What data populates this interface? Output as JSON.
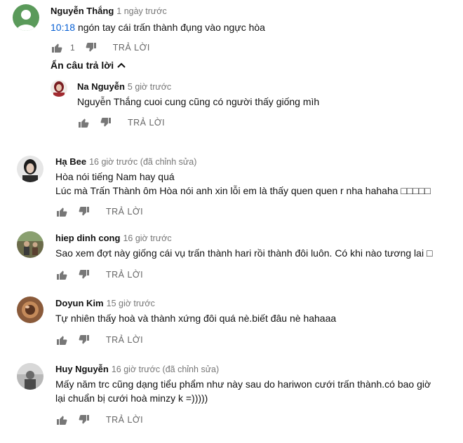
{
  "comments": [
    {
      "author": "Nguyễn Thắng",
      "time": "1 ngày trước",
      "timestamp_link": "10:18",
      "text": "ngón tay cái trấn thành đụng vào ngực hòa",
      "likes": "1",
      "reply_label": "TRẢ LỜI",
      "avatar_color": "#5a9a5a"
    },
    {
      "author": "Na Nguyễn",
      "time": "5 giờ trước",
      "text": "Nguyễn Thắng cuoi cung cũng có người thấy giống mìh",
      "reply_label": "TRẢ LỜI"
    },
    {
      "author": "Hạ Bee",
      "time": "16 giờ trước (đã chỉnh sửa)",
      "lines": [
        "Hòa nói tiếng Nam hay quá",
        "Lúc mà Trấn Thành ôm Hòa nói anh xin lỗi em là thấy quen quen r nha hahaha □□□□□"
      ],
      "reply_label": "TRẢ LỜI"
    },
    {
      "author": "hiep dinh cong",
      "time": "16 giờ trước",
      "text": "Sao xem đợt này giống cái vụ trấn thành hari rồi thành đôi luôn. Có khi nào tương lai □",
      "reply_label": "TRẢ LỜI"
    },
    {
      "author": "Doyun Kim",
      "time": "15 giờ trước",
      "text": "Tự nhiên thấy hoà và thành xứng đôi quá nè.biết đâu nè hahaaa",
      "reply_label": "TRẢ LỜI"
    },
    {
      "author": "Huy Nguyễn",
      "time": "16 giờ trước (đã chỉnh sửa)",
      "lines": [
        "Mấy năm trc cũng dạng tiểu phẩm như này sau do hariwon cưới trấn thành.có bao giờ",
        "lại chuẩn bị cưới hoà minzy k =)))))"
      ],
      "reply_label": "TRẢ LỜI"
    }
  ],
  "replies_toggle": {
    "label": "Ẩn câu trả lời",
    "icon": "chevron-up-icon"
  }
}
